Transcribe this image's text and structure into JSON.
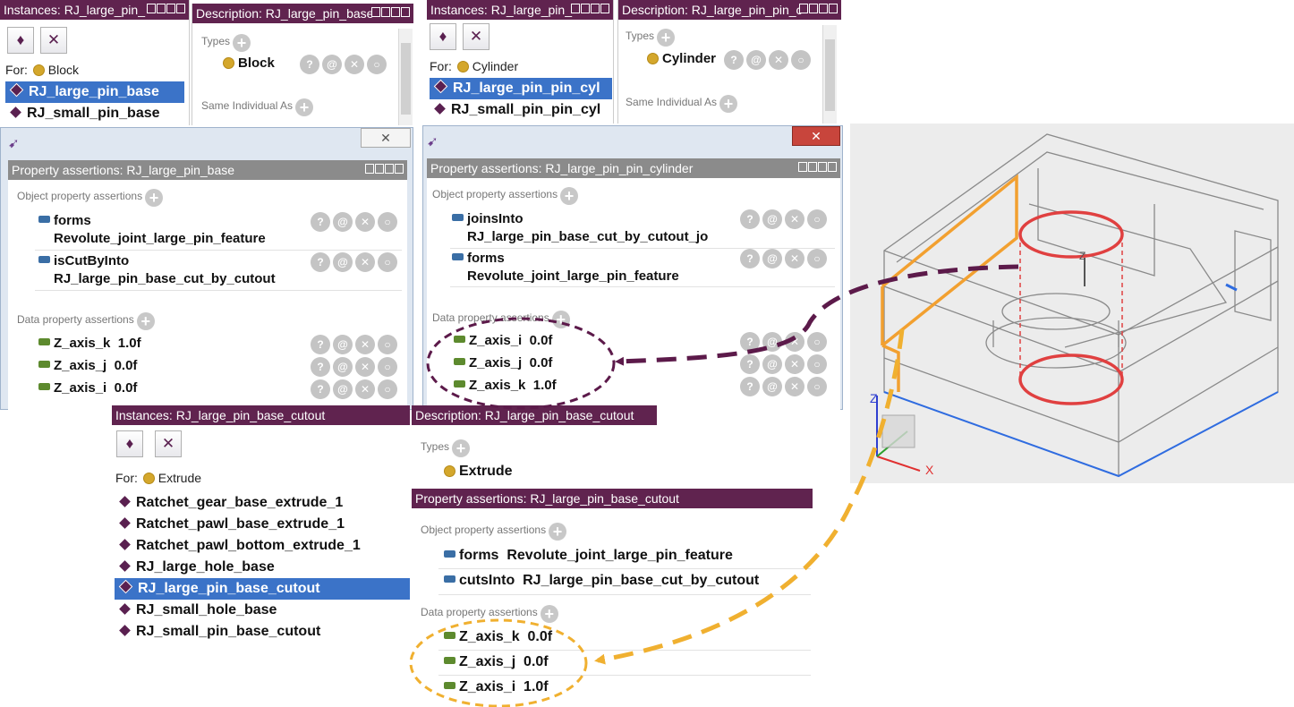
{
  "block_group": {
    "instances_title": "Instances: RJ_large_pin_",
    "description_title": "Description: RJ_large_pin_base",
    "for_label": "For:",
    "class_name": "Block",
    "instances": [
      "RJ_large_pin_base",
      "RJ_small_pin_base"
    ],
    "types_label": "Types",
    "type_value": "Block",
    "same_individual_label": "Same Individual As",
    "property_title": "Property assertions: RJ_large_pin_base",
    "object_props_label": "Object property assertions",
    "object_props": [
      {
        "name": "forms",
        "value": "Revolute_joint_large_pin_feature"
      },
      {
        "name": "isCutByInto",
        "value": "RJ_large_pin_base_cut_by_cutout"
      }
    ],
    "data_props_label": "Data property assertions",
    "data_props": [
      {
        "name": "Z_axis_k",
        "value": "1.0f"
      },
      {
        "name": "Z_axis_j",
        "value": "0.0f"
      },
      {
        "name": "Z_axis_i",
        "value": "0.0f"
      }
    ]
  },
  "cylinder_group": {
    "instances_title": "Instances: RJ_large_pin_",
    "description_title": "Description: RJ_large_pin_pin_c",
    "for_label": "For:",
    "class_name": "Cylinder",
    "instances": [
      "RJ_large_pin_pin_cyl",
      "RJ_small_pin_pin_cyl"
    ],
    "types_label": "Types",
    "type_value": "Cylinder",
    "same_individual_label": "Same Individual As",
    "property_title": "Property assertions: RJ_large_pin_pin_cylinder",
    "object_props_label": "Object property assertions",
    "object_props": [
      {
        "name": "joinsInto",
        "value": "RJ_large_pin_base_cut_by_cutout_jo"
      },
      {
        "name": "forms",
        "value": "Revolute_joint_large_pin_feature"
      }
    ],
    "data_props_label": "Data property assertions",
    "data_props": [
      {
        "name": "Z_axis_i",
        "value": "0.0f"
      },
      {
        "name": "Z_axis_j",
        "value": "0.0f"
      },
      {
        "name": "Z_axis_k",
        "value": "1.0f"
      }
    ]
  },
  "extrude_group": {
    "instances_title": "Instances: RJ_large_pin_base_cutout",
    "description_title": "Description: RJ_large_pin_base_cutout",
    "for_label": "For:",
    "class_name": "Extrude",
    "instances": [
      "Ratchet_gear_base_extrude_1",
      "Ratchet_pawl_base_extrude_1",
      "Ratchet_pawl_bottom_extrude_1",
      "RJ_large_hole_base",
      "RJ_large_pin_base_cutout",
      "RJ_small_hole_base",
      "RJ_small_pin_base_cutout"
    ],
    "types_label": "Types",
    "type_value": "Extrude",
    "property_title": "Property assertions: RJ_large_pin_base_cutout",
    "object_props_label": "Object property assertions",
    "object_props": [
      {
        "name": "forms",
        "value": "Revolute_joint_large_pin_feature"
      },
      {
        "name": "cutsInto",
        "value": "RJ_large_pin_base_cut_by_cutout"
      }
    ],
    "data_props_label": "Data property assertions",
    "data_props": [
      {
        "name": "Z_axis_k",
        "value": "0.0f"
      },
      {
        "name": "Z_axis_j",
        "value": "0.0f"
      },
      {
        "name": "Z_axis_i",
        "value": "1.0f"
      }
    ]
  },
  "icons": {
    "add_individual": "add-individual-icon",
    "delete_individual": "delete-individual-icon",
    "plus": "plus-icon",
    "explain": "explain-icon",
    "annotate": "annotate-icon",
    "delete": "delete-icon",
    "edit": "edit-icon",
    "close": "close-icon",
    "app": "protege-icon"
  },
  "window_close_glyph": "✕",
  "action_glyphs": [
    "?",
    "@",
    "✕",
    "○"
  ],
  "cad_axes": {
    "z": "Z",
    "x": "X"
  },
  "colors": {
    "title_bar": "#60234f",
    "selection": "#3b73c8",
    "class_dot": "#d4a72c",
    "object_prop": "#3a6ea5",
    "data_prop": "#5d8a2e",
    "arrow_purple": "#5c1a4a",
    "arrow_orange": "#f0b030",
    "highlight_red": "#e04040",
    "highlight_orange": "#f2a030"
  }
}
